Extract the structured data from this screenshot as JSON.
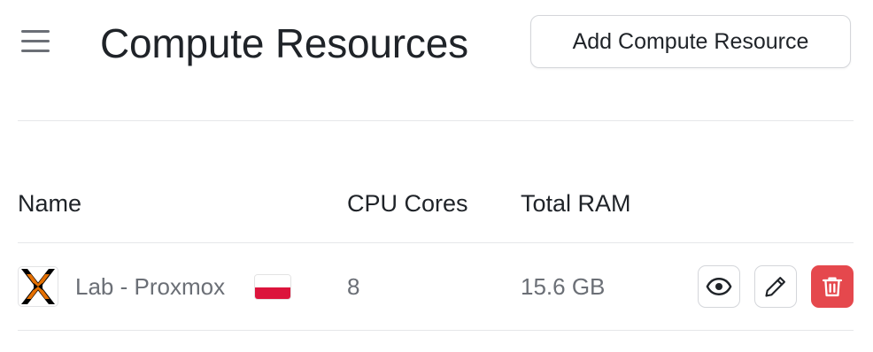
{
  "header": {
    "title": "Compute Resources",
    "add_button_label": "Add Compute Resource"
  },
  "table": {
    "columns": [
      "Name",
      "CPU Cores",
      "Total RAM"
    ],
    "rows": [
      {
        "name": "Lab - Proxmox",
        "provider_icon": "proxmox-icon",
        "flag_icon": "poland-flag-icon",
        "cpu_cores": "8",
        "total_ram": "15.6 GB",
        "actions": [
          "view-icon",
          "edit-icon",
          "delete-icon"
        ]
      }
    ]
  },
  "colors": {
    "danger": "#e5484d",
    "muted_text": "#6b6f76",
    "proxmox_orange": "#e57000"
  }
}
